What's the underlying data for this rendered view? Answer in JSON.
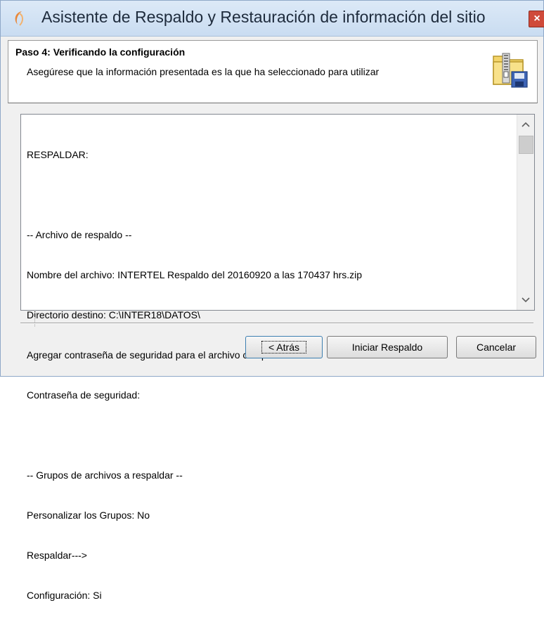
{
  "window": {
    "title": "Asistente de Respaldo y Restauración de información del sitio",
    "close_label": "×",
    "accent_color": "#cf4a3a"
  },
  "header": {
    "step_title": "Paso 4: Verificando la configuración",
    "step_description": "Asegúrese que la información presentada es la que ha seleccionado para utilizar",
    "icon": "zip-archive-disk-icon"
  },
  "summary": {
    "lines": [
      "RESPALDAR:",
      "",
      "-- Archivo de respaldo --",
      "Nombre del archivo: INTERTEL Respaldo del 20160920 a las 170437 hrs.zip",
      "Directorio destino: C:\\INTER18\\DATOS\\",
      "Agregar contraseña de seguridad para el archivo comprimido: No",
      "Contraseña de seguridad:",
      "",
      "-- Grupos de archivos a respaldar --",
      "Personalizar los Grupos: No",
      "Respaldar--->",
      "Configuración: Si"
    ]
  },
  "scrollbar": {
    "up_glyph": "^",
    "down_glyph": "v"
  },
  "buttons": {
    "back": "< Atrás",
    "start": "Iniciar Respaldo",
    "cancel": "Cancelar"
  }
}
